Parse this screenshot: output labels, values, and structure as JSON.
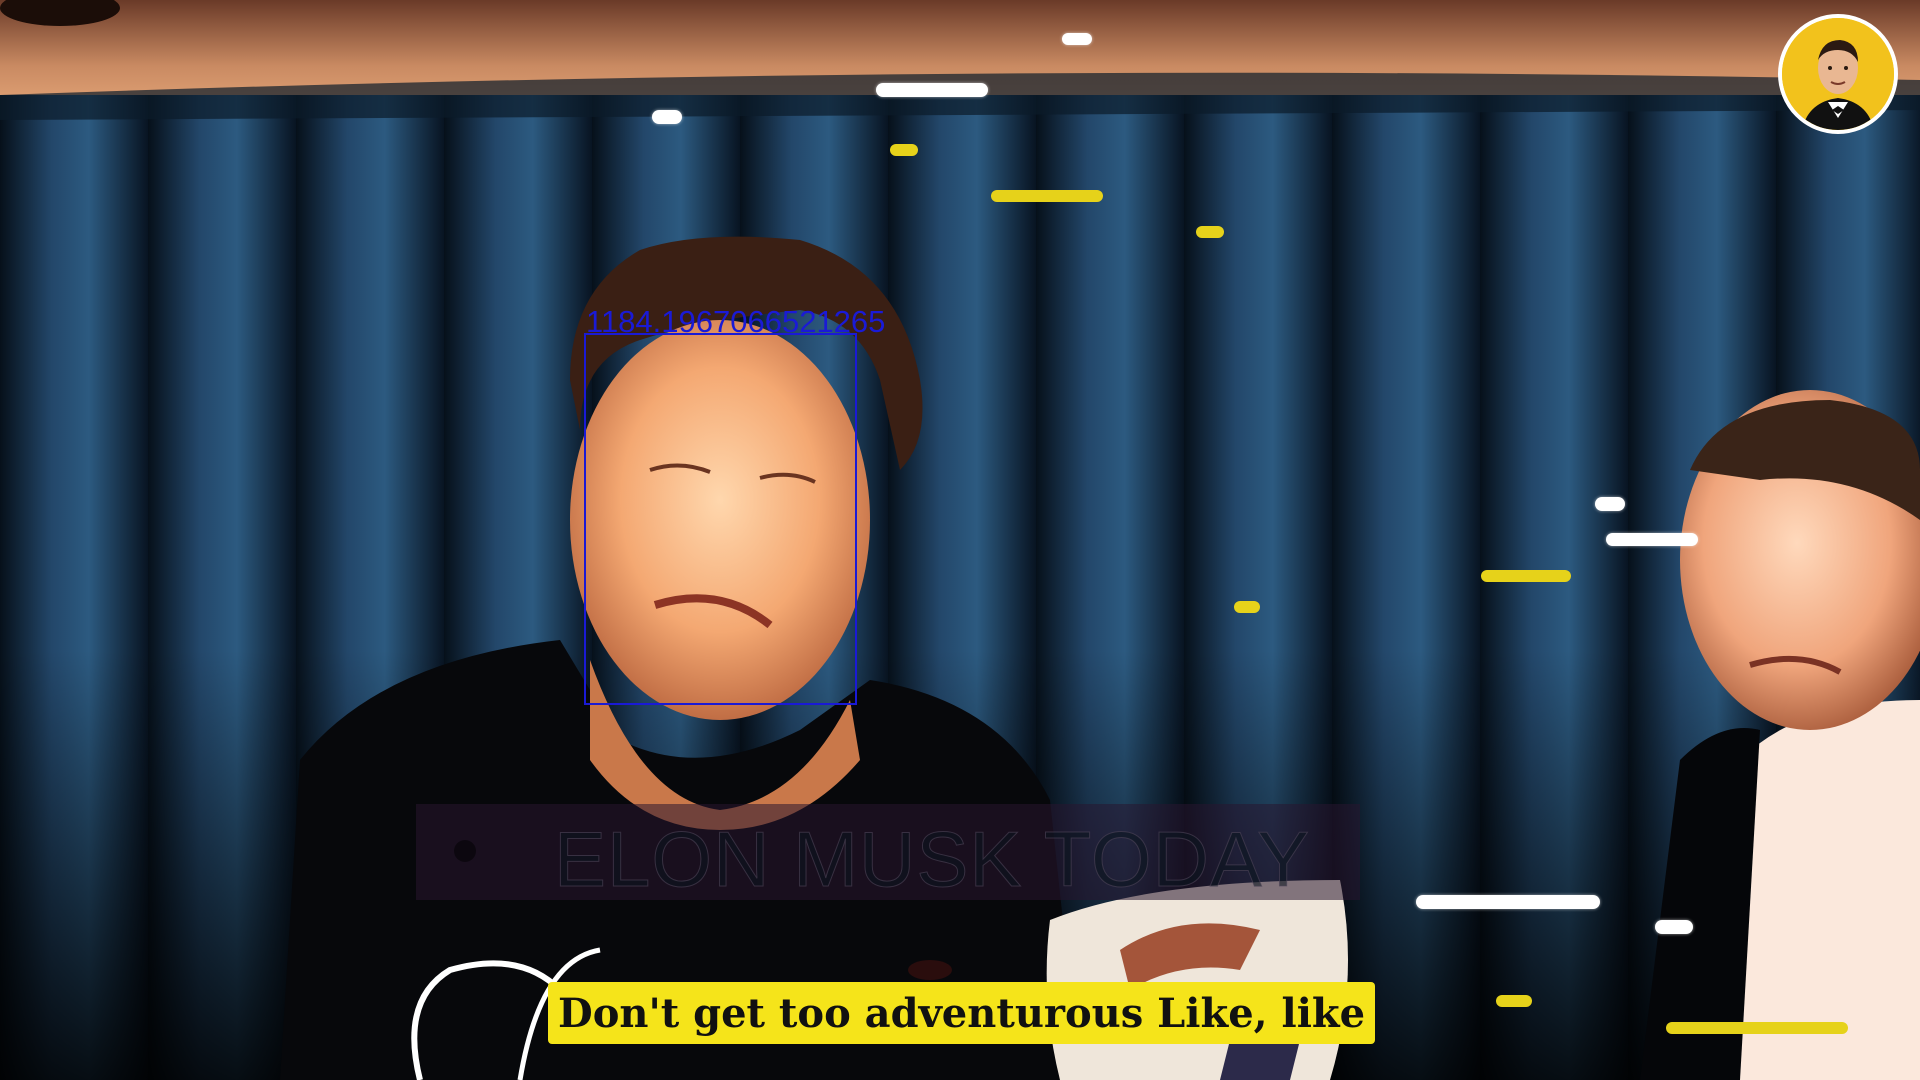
{
  "video": {
    "subtitle": "Don't get too adventurous Like, like",
    "watermark": "ELON MUSK TODAY",
    "detection_label": "1184.1967066521265"
  },
  "colors": {
    "subtitle_bg": "#f5e41a",
    "detection_box": "#1a1ad6",
    "avatar_bg": "#f2c21c",
    "streak_yellow": "#e6d21a"
  },
  "icons": {
    "channel_avatar": "avatar-portrait-icon"
  }
}
